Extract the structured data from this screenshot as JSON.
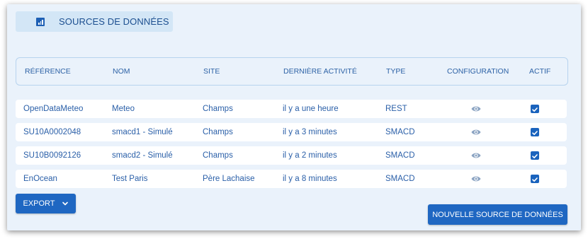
{
  "page": {
    "title": "SOURCES DE DONNÉES",
    "title_icon": "bar-chart-icon"
  },
  "table": {
    "headers": {
      "reference": "RÉFÉRENCE",
      "nom": "NOM",
      "site": "SITE",
      "activite": "DERNIÈRE ACTIVITÉ",
      "type": "TYPE",
      "configuration": "CONFIGURATION",
      "actif": "ACTIF"
    },
    "rows": [
      {
        "reference": "OpenDataMeteo",
        "nom": "Meteo",
        "site": "Champs",
        "activite": "il y a une heure",
        "type": "REST",
        "actif": true
      },
      {
        "reference": "SU10A0002048",
        "nom": "smacd1 - Simulé",
        "site": "Champs",
        "activite": "il y a 3 minutes",
        "type": "SMACD",
        "actif": true
      },
      {
        "reference": "SU10B0092126",
        "nom": "smacd2 - Simulé",
        "site": "Champs",
        "activite": "il y a 2 minutes",
        "type": "SMACD",
        "actif": true
      },
      {
        "reference": "EnOcean",
        "nom": "Test Paris",
        "site": "Père Lachaise",
        "activite": "il y a 8 minutes",
        "type": "SMACD",
        "actif": true
      }
    ]
  },
  "actions": {
    "export_label": "EXPORT",
    "new_source_label": "NOUVELLE SOURCE DE DONNÉES"
  },
  "colors": {
    "accent": "#1f67c2",
    "panel_bg": "#eaf2fb",
    "text": "#2a5fa8"
  }
}
